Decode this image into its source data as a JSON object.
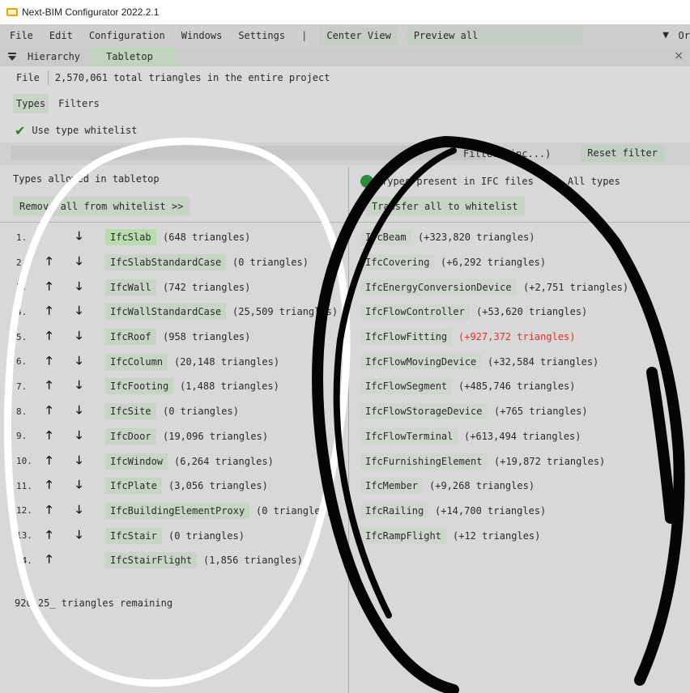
{
  "window": {
    "title": "Next-BIM Configurator 2022.2.1"
  },
  "menu": {
    "items": [
      "File",
      "Edit",
      "Configuration",
      "Windows",
      "Settings"
    ],
    "separator": "|",
    "center_view": "Center View",
    "preview_all": "Preview all",
    "dropdown_arrow": "▼",
    "overflow": "Or"
  },
  "tabs": {
    "hierarchy": "Hierarchy",
    "tabletop": "Tabletop",
    "close": "×"
  },
  "file_row": {
    "label": "File",
    "value": "2,570,061 total triangles in the entire project"
  },
  "subtabs": {
    "types": "Types",
    "filters": "Filters"
  },
  "whitelist": {
    "checkbox_label": "Use type whitelist",
    "checked": true
  },
  "filter": {
    "label": "Filter (inc...)",
    "reset": "Reset filter"
  },
  "left_pane": {
    "header": "Types allowed in tabletop",
    "remove_button": "Remove all from whitelist >>",
    "remaining": "920,25_ triangles remaining",
    "rows": [
      {
        "num": "1.",
        "name": "IfcSlab",
        "count": "(648 triangles)",
        "up": false,
        "down": true,
        "highlight": true
      },
      {
        "num": "2.",
        "name": "IfcSlabStandardCase",
        "count": "(0 triangles)",
        "up": true,
        "down": true
      },
      {
        "num": "3.",
        "name": "IfcWall",
        "count": "(742 triangles)",
        "up": true,
        "down": true
      },
      {
        "num": "4.",
        "name": "IfcWallStandardCase",
        "count": "(25,509 triangles)",
        "up": true,
        "down": true
      },
      {
        "num": "5.",
        "name": "IfcRoof",
        "count": "(958 triangles)",
        "up": true,
        "down": true
      },
      {
        "num": "6.",
        "name": "IfcColumn",
        "count": "(20,148 triangles)",
        "up": true,
        "down": true
      },
      {
        "num": "7.",
        "name": "IfcFooting",
        "count": "(1,488 triangles)",
        "up": true,
        "down": true
      },
      {
        "num": "8.",
        "name": "IfcSite",
        "count": "(0 triangles)",
        "up": true,
        "down": true
      },
      {
        "num": "9.",
        "name": "IfcDoor",
        "count": "(19,096 triangles)",
        "up": true,
        "down": true
      },
      {
        "num": "10.",
        "name": "IfcWindow",
        "count": "(6,264 triangles)",
        "up": true,
        "down": true
      },
      {
        "num": "11.",
        "name": "IfcPlate",
        "count": "(3,056 triangles)",
        "up": true,
        "down": true
      },
      {
        "num": "12.",
        "name": "IfcBuildingElementProxy",
        "count": "(0 triangles)",
        "up": true,
        "down": true
      },
      {
        "num": "13.",
        "name": "IfcStair",
        "count": "(0 triangles)",
        "up": true,
        "down": true
      },
      {
        "num": "14.",
        "name": "IfcStairFlight",
        "count": "(1,856 triangles)",
        "up": true,
        "down": false
      }
    ]
  },
  "right_pane": {
    "radio_present": "Types present in IFC files",
    "radio_all": "All types",
    "transfer_button": "Transfer all to whitelist",
    "rows": [
      {
        "name": "IfcBeam",
        "count": "(+323,820 triangles)"
      },
      {
        "name": "IfcCovering",
        "count": "(+6,292 triangles)"
      },
      {
        "name": "IfcEnergyConversionDevice",
        "count": "(+2,751 triangles)"
      },
      {
        "name": "IfcFlowController",
        "count": "(+53,620 triangles)"
      },
      {
        "name": "IfcFlowFitting",
        "count": "(+927,372 triangles)",
        "warn": true
      },
      {
        "name": "IfcFlowMovingDevice",
        "count": "(+32,584 triangles)"
      },
      {
        "name": "IfcFlowSegment",
        "count": "(+485,746 triangles)"
      },
      {
        "name": "IfcFlowStorageDevice",
        "count": "(+765 triangles)"
      },
      {
        "name": "IfcFlowTerminal",
        "count": "(+613,494 triangles)"
      },
      {
        "name": "IfcFurnishingElement",
        "count": "(+19,872 triangles)"
      },
      {
        "name": "IfcMember",
        "count": "(+9,268 triangles)"
      },
      {
        "name": "IfcRailing",
        "count": "(+14,700 triangles)"
      },
      {
        "name": "IfcRampFlight",
        "count": "(+12 triangles)"
      }
    ]
  },
  "colors": {
    "accent_green": "#2e8b3c",
    "warning_red": "#e03030",
    "button_bg": "#c8d5c6"
  },
  "icons": {
    "up": "arrow-up-icon",
    "down": "arrow-down-icon",
    "check": "check-icon"
  }
}
